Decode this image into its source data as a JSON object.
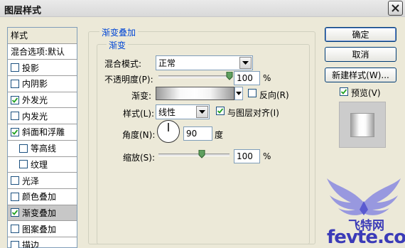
{
  "window": {
    "title": "图层样式"
  },
  "sidebar": {
    "header": "样式",
    "items": [
      {
        "label": "混合选项:默认",
        "checkbox": false,
        "checked": false,
        "selected": false,
        "indent": false
      },
      {
        "label": "投影",
        "checkbox": true,
        "checked": false,
        "selected": false,
        "indent": false
      },
      {
        "label": "内阴影",
        "checkbox": true,
        "checked": false,
        "selected": false,
        "indent": false
      },
      {
        "label": "外发光",
        "checkbox": true,
        "checked": true,
        "selected": false,
        "indent": false
      },
      {
        "label": "内发光",
        "checkbox": true,
        "checked": false,
        "selected": false,
        "indent": false
      },
      {
        "label": "斜面和浮雕",
        "checkbox": true,
        "checked": true,
        "selected": false,
        "indent": false
      },
      {
        "label": "等高线",
        "checkbox": true,
        "checked": false,
        "selected": false,
        "indent": true
      },
      {
        "label": "纹理",
        "checkbox": true,
        "checked": false,
        "selected": false,
        "indent": true
      },
      {
        "label": "光泽",
        "checkbox": true,
        "checked": false,
        "selected": false,
        "indent": false
      },
      {
        "label": "颜色叠加",
        "checkbox": true,
        "checked": false,
        "selected": false,
        "indent": false
      },
      {
        "label": "渐变叠加",
        "checkbox": true,
        "checked": true,
        "selected": true,
        "indent": false
      },
      {
        "label": "图案叠加",
        "checkbox": true,
        "checked": false,
        "selected": false,
        "indent": false
      },
      {
        "label": "描边",
        "checkbox": true,
        "checked": false,
        "selected": false,
        "indent": false
      }
    ]
  },
  "panel": {
    "outer_legend": "渐变叠加",
    "inner_legend": "渐变",
    "blend_mode": {
      "label": "混合模式:",
      "value": "正常"
    },
    "opacity": {
      "label": "不透明度(P):",
      "value": "100",
      "unit": "%",
      "percent": 100
    },
    "gradient": {
      "label": "渐变:",
      "reverse_label": "反向(R)",
      "reverse_checked": false
    },
    "style": {
      "label": "样式(L):",
      "value": "线性",
      "align_label": "与图层对齐(I)",
      "align_checked": true
    },
    "angle": {
      "label": "角度(N):",
      "value": "90",
      "unit": "度",
      "degrees": 90
    },
    "scale": {
      "label": "缩放(S):",
      "value": "100",
      "unit": "%",
      "percent": 100
    }
  },
  "buttons": {
    "ok": "确定",
    "cancel": "取消",
    "new_style": "新建样式(W)...",
    "preview_label": "预览(V)",
    "preview_checked": true
  },
  "watermark": {
    "text_cn": "飞特网",
    "text_url": "fevte.com"
  },
  "colors": {
    "legend": "#0046d5",
    "dialog_bg": "#ece9d8",
    "selected_row": "#c7c7c7",
    "watermark": "#3b3bb8"
  }
}
